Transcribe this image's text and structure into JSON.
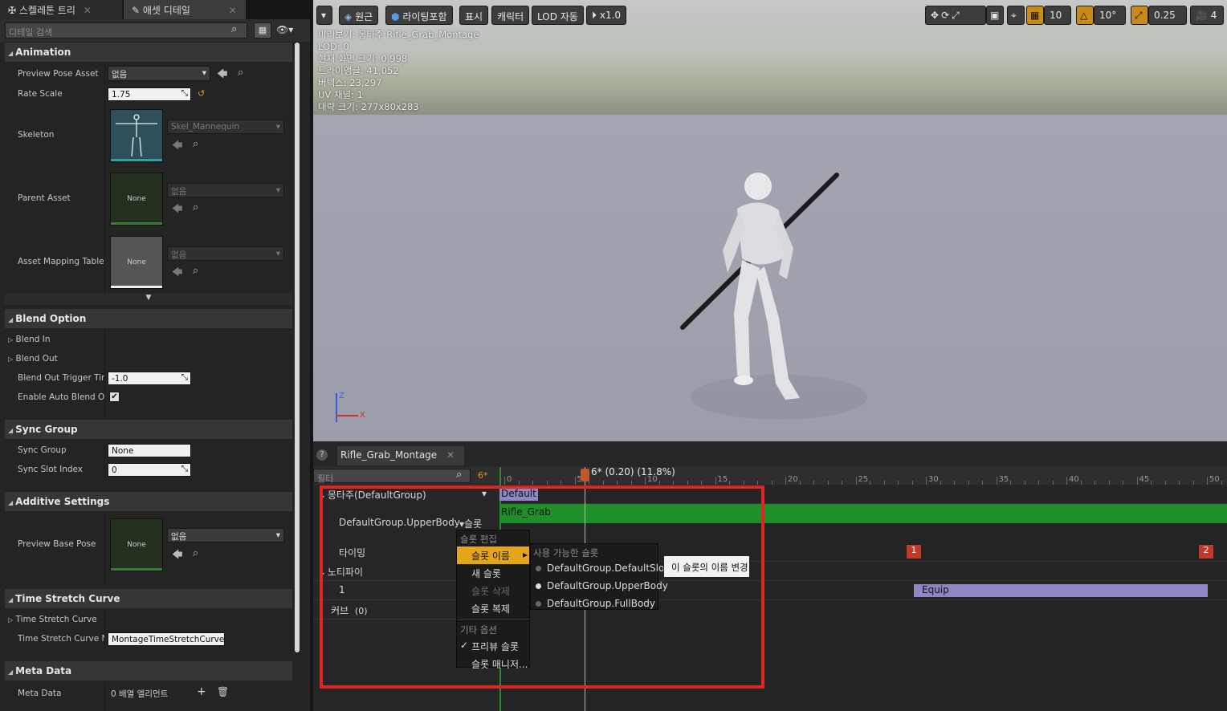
{
  "left_panel": {
    "tabs": [
      {
        "label": "스켈레톤 트리",
        "icon": "bone-icon"
      },
      {
        "label": "애셋 디테일",
        "icon": "asset-icon"
      }
    ],
    "search_placeholder": "디테일 검색",
    "animation": {
      "header": "Animation",
      "preview_pose_label": "Preview Pose Asset",
      "preview_pose_value": "없음",
      "rate_scale_label": "Rate Scale",
      "rate_scale_value": "1.75",
      "skeleton_label": "Skeleton",
      "skeleton_value": "Skel_Mannequin",
      "parent_asset_label": "Parent Asset",
      "parent_asset_thumb": "None",
      "parent_asset_value": "없음",
      "asset_mapping_label": "Asset Mapping Table",
      "asset_mapping_thumb": "None",
      "asset_mapping_value": "없음"
    },
    "blend_option": {
      "header": "Blend Option",
      "blend_in": "Blend In",
      "blend_out": "Blend Out",
      "trigger_label": "Blend Out Trigger Tim",
      "trigger_value": "-1.0",
      "auto_label": "Enable Auto Blend Ou",
      "auto_checked": true
    },
    "sync_group": {
      "header": "Sync Group",
      "group_label": "Sync Group",
      "group_value": "None",
      "slot_label": "Sync Slot Index",
      "slot_value": "0"
    },
    "additive": {
      "header": "Additive Settings",
      "base_pose_label": "Preview Base Pose",
      "base_pose_thumb": "None",
      "base_pose_value": "없음"
    },
    "time_stretch": {
      "header": "Time Stretch Curve",
      "curve_label": "Time Stretch Curve",
      "curve_name_label": "Time Stretch Curve N",
      "curve_name_value": "MontageTimeStretchCurve"
    },
    "meta": {
      "header": "Meta Data",
      "label": "Meta Data",
      "value": "0 배열 엘리먼트"
    }
  },
  "viewport": {
    "buttons": [
      "원근",
      "라이팅포함",
      "표시",
      "캐릭터",
      "LOD 자동",
      "x1.0"
    ],
    "right_values": [
      "10",
      "10°",
      "0.25",
      "4"
    ],
    "info": [
      "미리보기: 몽타주 Rifle_Grab_Montage",
      "LOD: 0",
      "현재 화면 크기: 0.998",
      "트라이앵글: 41,052",
      "버텍스: 23,297",
      "UV 채널: 1",
      "대략 크기: 277x80x283"
    ],
    "axis_z": "Z",
    "axis_x": "X"
  },
  "timeline": {
    "tab": "Rifle_Grab_Montage",
    "filter_placeholder": "필터",
    "frame_marker": "6*",
    "scrub_label": "6* (0.20) (11.8%)",
    "ticks": [
      "0",
      "5",
      "10",
      "15",
      "20",
      "25",
      "30",
      "35",
      "40",
      "45",
      "50"
    ],
    "rows": {
      "montage": "몽타주(DefaultGroup)",
      "slot": "DefaultGroup.UpperBody",
      "slot_btn": "슬롯",
      "timing": "타이밍",
      "notify": "노티파이",
      "notify_track": "1",
      "curve": "커브",
      "curve_count": "(0)"
    },
    "section_default": "Default",
    "segment_name": "Rifle_Grab",
    "markers": [
      "1",
      "2"
    ],
    "notify_name": "Equip"
  },
  "context_menu": {
    "section_edit": "슬롯 편집",
    "items": [
      "슬롯 이름",
      "새 슬롯",
      "슬롯 삭제",
      "슬롯 복제"
    ],
    "section_other": "기타 옵션",
    "preview_slot": "프리뷰 슬롯",
    "slot_manager": "슬롯 매니저..."
  },
  "submenu": {
    "section": "사용 가능한 슬롯",
    "items": [
      "DefaultGroup.DefaultSlot",
      "DefaultGroup.UpperBody",
      "DefaultGroup.FullBody"
    ]
  },
  "tooltip": "이 슬롯의 이름 변경",
  "colors": {
    "accent": "#e5a51a",
    "segment_green": "#1f8f2a",
    "notify_purple": "#8d87c4",
    "highlight_red": "#e02525",
    "marker_red": "#c0392b"
  }
}
